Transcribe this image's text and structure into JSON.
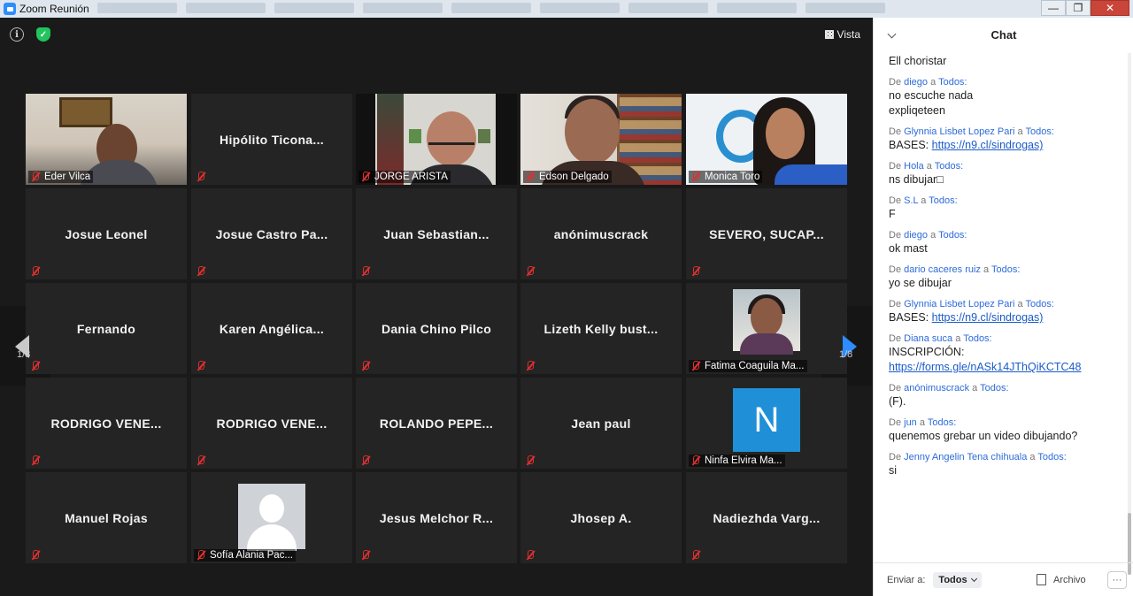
{
  "window": {
    "title": "Zoom Reunión",
    "minimize": "—",
    "maximize": "❐",
    "close": "✕"
  },
  "meeting": {
    "info_icon": "i",
    "shield_icon": "✓",
    "view_label": "Vista",
    "page_left": "1/8",
    "page_right": "1/8"
  },
  "participants": [
    {
      "name": "Eder Vilca",
      "type": "video",
      "photo": "eder"
    },
    {
      "name": "Hipólito  Ticona...",
      "type": "name"
    },
    {
      "name": "JORGE ARISTA",
      "type": "video",
      "photo": "jorge",
      "active": true
    },
    {
      "name": "Edson Delgado",
      "type": "video",
      "photo": "edson"
    },
    {
      "name": "Monica Toro",
      "type": "video",
      "photo": "monica"
    },
    {
      "name": "Josue Leonel",
      "type": "name"
    },
    {
      "name": "Josue Castro Pa...",
      "type": "name"
    },
    {
      "name": "Juan  Sebastian...",
      "type": "name"
    },
    {
      "name": "anónimuscrack",
      "type": "name"
    },
    {
      "name": "SEVERO,  SUCAP...",
      "type": "name"
    },
    {
      "name": "Fernando",
      "type": "name"
    },
    {
      "name": "Karen  Angélica...",
      "type": "name"
    },
    {
      "name": "Dania Chino Pilco",
      "type": "name"
    },
    {
      "name": "Lizeth Kelly bust...",
      "type": "name"
    },
    {
      "name": "Fatima Coaguila Ma...",
      "type": "avatar",
      "photo": "fatima"
    },
    {
      "name": "RODRIGO  VENE...",
      "type": "name"
    },
    {
      "name": "RODRIGO  VENE...",
      "type": "name"
    },
    {
      "name": "ROLANDO  PEPE...",
      "type": "name"
    },
    {
      "name": "Jean paul",
      "type": "name"
    },
    {
      "name": "Ninfa Elvira Ma...",
      "type": "avatar",
      "photo": "n",
      "initial": "N"
    },
    {
      "name": "Manuel Rojas",
      "type": "name"
    },
    {
      "name": "Sofía Alania Pac...",
      "type": "avatar",
      "photo": "sofia"
    },
    {
      "name": "Jesus Melchor R...",
      "type": "name"
    },
    {
      "name": "Jhosep A.",
      "type": "name"
    },
    {
      "name": "Nadiezhda  Varg...",
      "type": "name"
    }
  ],
  "chat": {
    "title": "Chat",
    "first_line": "Ell choristar",
    "messages": [
      {
        "from": "diego",
        "to": "Todos:",
        "lines": [
          "no escuche nada",
          "expliqeteen"
        ]
      },
      {
        "from": "Glynnia Lisbet Lopez Pari",
        "to": "Todos:",
        "prefix": "BASES: ",
        "link": "https://n9.cl/sindrogas)"
      },
      {
        "from": "Hola",
        "to": "Todos:",
        "lines": [
          "ns dibujar□"
        ]
      },
      {
        "from": "S.L",
        "to": "Todos:",
        "lines": [
          "F"
        ]
      },
      {
        "from": "diego",
        "to": "Todos:",
        "lines": [
          "ok mast"
        ]
      },
      {
        "from": "dario caceres ruiz",
        "to": "Todos:",
        "lines": [
          "yo se dibujar"
        ]
      },
      {
        "from": "Glynnia Lisbet Lopez Pari",
        "to": "Todos:",
        "prefix": "BASES: ",
        "link": "https://n9.cl/sindrogas)"
      },
      {
        "from": "Diana suca",
        "to": "Todos:",
        "lines": [
          "INSCRIPCIÓN:"
        ],
        "link": "https://forms.gle/nASk14JThQiKCTC48"
      },
      {
        "from": "anónimuscrack",
        "to": "Todos:",
        "lines": [
          "(F)."
        ]
      },
      {
        "from": "jun",
        "to": "Todos:",
        "lines": [
          " quenemos grebar un video dibujando?"
        ]
      },
      {
        "from": "Jenny Angelin Tena chihuala",
        "to": "Todos:",
        "lines": [
          "si"
        ]
      }
    ],
    "de_label": "De",
    "a_label": "a",
    "footer": {
      "send_to_label": "Enviar a:",
      "send_to_value": "Todos",
      "file_label": "Archivo",
      "more_label": "···"
    }
  },
  "colors": {
    "active_speaker": "#cde65a",
    "accent": "#2d8cff",
    "muted_mic": "#e02f2f"
  }
}
